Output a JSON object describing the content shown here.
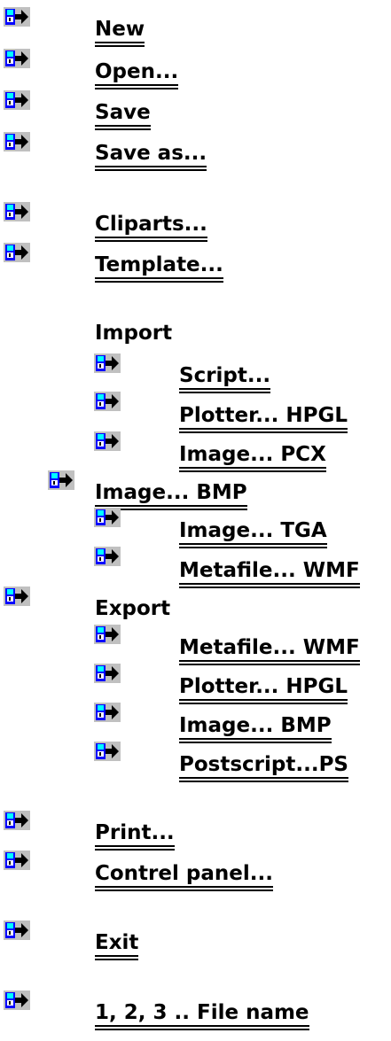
{
  "menu": {
    "new": "New",
    "open": "Open...",
    "save": "Save",
    "save_as": "Save as...",
    "cliparts": "Cliparts...",
    "template": "Template...",
    "import_heading": "Import",
    "import_items": {
      "script": "Script...",
      "plotter_hpgl": "Plotter... HPGL",
      "image_pcx": "Image... PCX",
      "image_bmp": "Image... BMP",
      "image_tga": "Image... TGA",
      "metafile_wmf": "Metafile... WMF"
    },
    "export_heading": "Export",
    "export_items": {
      "metafile_wmf": "Metafile... WMF",
      "plotter_hpgl": "Plotter... HPGL",
      "image_bmp": "Image... BMP",
      "postscript_ps": "Postscript...PS"
    },
    "print": "Print...",
    "control_panel": "Contrel panel...",
    "exit": "Exit",
    "recent_files": "1, 2, 3 .. File name"
  },
  "icons": {
    "jump": "jump-arrow-icon"
  },
  "colors": {
    "icon_gray": "#c0c0c0",
    "icon_cyan": "#00ffff",
    "icon_blue": "#0000ff",
    "text": "#000000",
    "background": "#ffffff"
  }
}
